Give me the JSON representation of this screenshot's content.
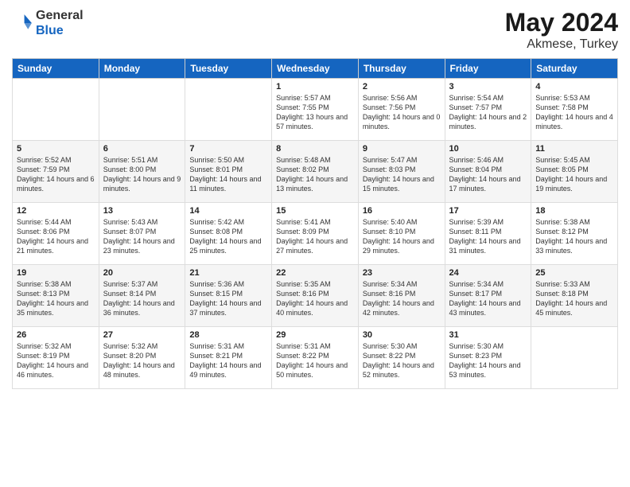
{
  "header": {
    "logo_line1": "General",
    "logo_line2": "Blue",
    "month": "May 2024",
    "location": "Akmese, Turkey"
  },
  "weekdays": [
    "Sunday",
    "Monday",
    "Tuesday",
    "Wednesday",
    "Thursday",
    "Friday",
    "Saturday"
  ],
  "weeks": [
    [
      {
        "day": "",
        "sunrise": "",
        "sunset": "",
        "daylight": ""
      },
      {
        "day": "",
        "sunrise": "",
        "sunset": "",
        "daylight": ""
      },
      {
        "day": "",
        "sunrise": "",
        "sunset": "",
        "daylight": ""
      },
      {
        "day": "1",
        "sunrise": "Sunrise: 5:57 AM",
        "sunset": "Sunset: 7:55 PM",
        "daylight": "Daylight: 13 hours and 57 minutes."
      },
      {
        "day": "2",
        "sunrise": "Sunrise: 5:56 AM",
        "sunset": "Sunset: 7:56 PM",
        "daylight": "Daylight: 14 hours and 0 minutes."
      },
      {
        "day": "3",
        "sunrise": "Sunrise: 5:54 AM",
        "sunset": "Sunset: 7:57 PM",
        "daylight": "Daylight: 14 hours and 2 minutes."
      },
      {
        "day": "4",
        "sunrise": "Sunrise: 5:53 AM",
        "sunset": "Sunset: 7:58 PM",
        "daylight": "Daylight: 14 hours and 4 minutes."
      }
    ],
    [
      {
        "day": "5",
        "sunrise": "Sunrise: 5:52 AM",
        "sunset": "Sunset: 7:59 PM",
        "daylight": "Daylight: 14 hours and 6 minutes."
      },
      {
        "day": "6",
        "sunrise": "Sunrise: 5:51 AM",
        "sunset": "Sunset: 8:00 PM",
        "daylight": "Daylight: 14 hours and 9 minutes."
      },
      {
        "day": "7",
        "sunrise": "Sunrise: 5:50 AM",
        "sunset": "Sunset: 8:01 PM",
        "daylight": "Daylight: 14 hours and 11 minutes."
      },
      {
        "day": "8",
        "sunrise": "Sunrise: 5:48 AM",
        "sunset": "Sunset: 8:02 PM",
        "daylight": "Daylight: 14 hours and 13 minutes."
      },
      {
        "day": "9",
        "sunrise": "Sunrise: 5:47 AM",
        "sunset": "Sunset: 8:03 PM",
        "daylight": "Daylight: 14 hours and 15 minutes."
      },
      {
        "day": "10",
        "sunrise": "Sunrise: 5:46 AM",
        "sunset": "Sunset: 8:04 PM",
        "daylight": "Daylight: 14 hours and 17 minutes."
      },
      {
        "day": "11",
        "sunrise": "Sunrise: 5:45 AM",
        "sunset": "Sunset: 8:05 PM",
        "daylight": "Daylight: 14 hours and 19 minutes."
      }
    ],
    [
      {
        "day": "12",
        "sunrise": "Sunrise: 5:44 AM",
        "sunset": "Sunset: 8:06 PM",
        "daylight": "Daylight: 14 hours and 21 minutes."
      },
      {
        "day": "13",
        "sunrise": "Sunrise: 5:43 AM",
        "sunset": "Sunset: 8:07 PM",
        "daylight": "Daylight: 14 hours and 23 minutes."
      },
      {
        "day": "14",
        "sunrise": "Sunrise: 5:42 AM",
        "sunset": "Sunset: 8:08 PM",
        "daylight": "Daylight: 14 hours and 25 minutes."
      },
      {
        "day": "15",
        "sunrise": "Sunrise: 5:41 AM",
        "sunset": "Sunset: 8:09 PM",
        "daylight": "Daylight: 14 hours and 27 minutes."
      },
      {
        "day": "16",
        "sunrise": "Sunrise: 5:40 AM",
        "sunset": "Sunset: 8:10 PM",
        "daylight": "Daylight: 14 hours and 29 minutes."
      },
      {
        "day": "17",
        "sunrise": "Sunrise: 5:39 AM",
        "sunset": "Sunset: 8:11 PM",
        "daylight": "Daylight: 14 hours and 31 minutes."
      },
      {
        "day": "18",
        "sunrise": "Sunrise: 5:38 AM",
        "sunset": "Sunset: 8:12 PM",
        "daylight": "Daylight: 14 hours and 33 minutes."
      }
    ],
    [
      {
        "day": "19",
        "sunrise": "Sunrise: 5:38 AM",
        "sunset": "Sunset: 8:13 PM",
        "daylight": "Daylight: 14 hours and 35 minutes."
      },
      {
        "day": "20",
        "sunrise": "Sunrise: 5:37 AM",
        "sunset": "Sunset: 8:14 PM",
        "daylight": "Daylight: 14 hours and 36 minutes."
      },
      {
        "day": "21",
        "sunrise": "Sunrise: 5:36 AM",
        "sunset": "Sunset: 8:15 PM",
        "daylight": "Daylight: 14 hours and 37 minutes."
      },
      {
        "day": "22",
        "sunrise": "Sunrise: 5:35 AM",
        "sunset": "Sunset: 8:16 PM",
        "daylight": "Daylight: 14 hours and 40 minutes."
      },
      {
        "day": "23",
        "sunrise": "Sunrise: 5:34 AM",
        "sunset": "Sunset: 8:16 PM",
        "daylight": "Daylight: 14 hours and 42 minutes."
      },
      {
        "day": "24",
        "sunrise": "Sunrise: 5:34 AM",
        "sunset": "Sunset: 8:17 PM",
        "daylight": "Daylight: 14 hours and 43 minutes."
      },
      {
        "day": "25",
        "sunrise": "Sunrise: 5:33 AM",
        "sunset": "Sunset: 8:18 PM",
        "daylight": "Daylight: 14 hours and 45 minutes."
      }
    ],
    [
      {
        "day": "26",
        "sunrise": "Sunrise: 5:32 AM",
        "sunset": "Sunset: 8:19 PM",
        "daylight": "Daylight: 14 hours and 46 minutes."
      },
      {
        "day": "27",
        "sunrise": "Sunrise: 5:32 AM",
        "sunset": "Sunset: 8:20 PM",
        "daylight": "Daylight: 14 hours and 48 minutes."
      },
      {
        "day": "28",
        "sunrise": "Sunrise: 5:31 AM",
        "sunset": "Sunset: 8:21 PM",
        "daylight": "Daylight: 14 hours and 49 minutes."
      },
      {
        "day": "29",
        "sunrise": "Sunrise: 5:31 AM",
        "sunset": "Sunset: 8:22 PM",
        "daylight": "Daylight: 14 hours and 50 minutes."
      },
      {
        "day": "30",
        "sunrise": "Sunrise: 5:30 AM",
        "sunset": "Sunset: 8:22 PM",
        "daylight": "Daylight: 14 hours and 52 minutes."
      },
      {
        "day": "31",
        "sunrise": "Sunrise: 5:30 AM",
        "sunset": "Sunset: 8:23 PM",
        "daylight": "Daylight: 14 hours and 53 minutes."
      },
      {
        "day": "",
        "sunrise": "",
        "sunset": "",
        "daylight": ""
      }
    ]
  ]
}
